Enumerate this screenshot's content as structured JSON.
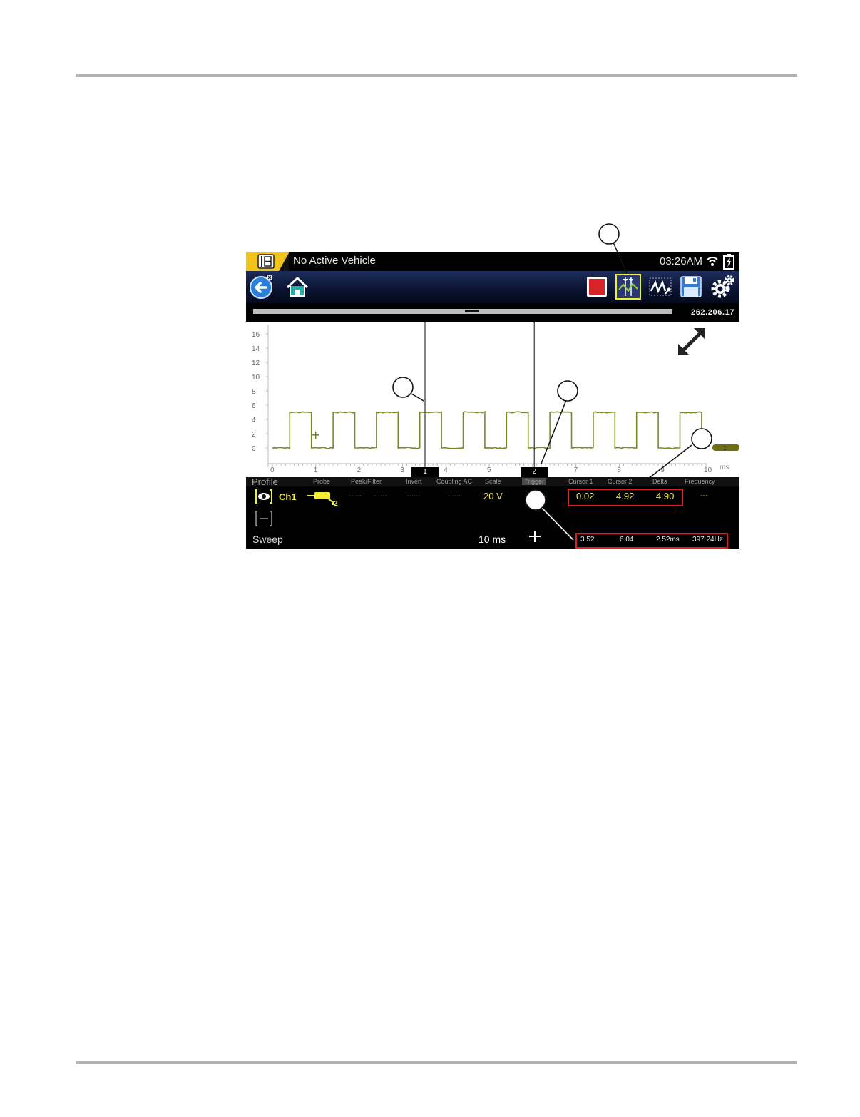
{
  "screen": {
    "title": "No Active Vehicle",
    "time": "03:26AM",
    "progress_value": "262.206.17"
  },
  "toolbar": {
    "buttons": [
      "back-icon",
      "home-icon",
      "stop-icon",
      "cursors-icon",
      "trigger-icon",
      "save-icon",
      "settings-icon"
    ]
  },
  "plot": {
    "y_ticks": [
      "16",
      "14",
      "12",
      "10",
      "8",
      "6",
      "4",
      "2",
      "0"
    ],
    "x_ticks": [
      "0",
      "1",
      "2",
      "3",
      "4",
      "5",
      "6",
      "7",
      "8",
      "9",
      "10"
    ],
    "x_unit": "ms",
    "cursor1_label": "1",
    "cursor2_label": "2",
    "trigger_marker_label": "1",
    "cursor1_ms": 3.52,
    "cursor2_ms": 6.04,
    "signal_low_v": 0,
    "signal_high_v": 5,
    "signal_period_ms": 1.0
  },
  "columns": {
    "profile": "Profile",
    "probe": "Probe",
    "peak_filter": "Peak/Filter",
    "invert": "Invert",
    "coupling": "Coupling AC",
    "scale": "Scale",
    "trigger": "Trigger",
    "cursor1": "Cursor 1",
    "cursor2": "Cursor 2",
    "delta": "Delta",
    "frequency": "Frequency"
  },
  "channel": {
    "name": "Ch1",
    "peak": "------",
    "filter": "------",
    "invert": "------",
    "coupling": "------",
    "scale": "20 V",
    "cursor1": "0.02",
    "cursor2": "4.92",
    "delta": "4.90",
    "frequency": "---"
  },
  "sweep": {
    "label": "Sweep",
    "value": "10 ms",
    "cursor1": "3.52",
    "cursor2": "6.04",
    "delta": "2.52ms",
    "frequency": "397.24Hz"
  },
  "colors": {
    "signal": "#7a8a22",
    "highlight": "#f2ee35",
    "box": "#e02020",
    "logo": "#f0c419"
  }
}
